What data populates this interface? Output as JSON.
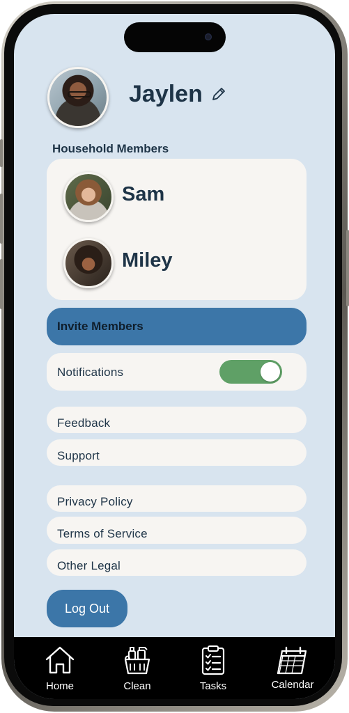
{
  "profile": {
    "name": "Jaylen",
    "avatar_icon": "profile-photo",
    "edit_icon": "pencil-icon"
  },
  "household": {
    "title": "Household Members",
    "members": [
      {
        "name": "Sam",
        "avatar_icon": "profile-photo"
      },
      {
        "name": "Miley",
        "avatar_icon": "profile-photo"
      }
    ]
  },
  "invite": {
    "label": "Invite Members"
  },
  "notifications": {
    "label": "Notifications",
    "enabled": true
  },
  "help_links": [
    {
      "label": "Feedback"
    },
    {
      "label": "Support"
    }
  ],
  "legal_links": [
    {
      "label": "Privacy Policy"
    },
    {
      "label": "Terms of Service"
    },
    {
      "label": "Other Legal"
    }
  ],
  "logout": {
    "label": "Log Out"
  },
  "tabs": [
    {
      "label": "Home",
      "icon": "home-icon"
    },
    {
      "label": "Clean",
      "icon": "cleaning-supplies-icon"
    },
    {
      "label": "Tasks",
      "icon": "checklist-icon"
    },
    {
      "label": "Calendar",
      "icon": "calendar-icon"
    }
  ],
  "colors": {
    "background": "#d8e4ef",
    "card": "#f7f5f2",
    "accent": "#3c76a8",
    "toggle_on": "#5fa066",
    "text": "#1e3447",
    "tab_bar": "#000000"
  }
}
